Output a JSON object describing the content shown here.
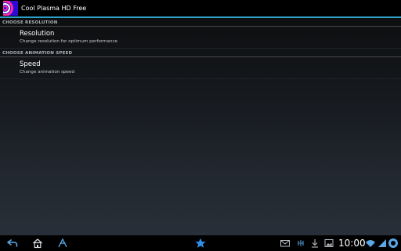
{
  "app": {
    "title": "Cool Plasma HD Free"
  },
  "sections": [
    {
      "header": "CHOOSE RESOLUTION",
      "item": {
        "title": "Resolution",
        "summary": "Change resolution for optimum performance"
      }
    },
    {
      "header": "CHOOSE ANIMATION SPEED",
      "item": {
        "title": "Speed",
        "summary": "Change animation speed"
      }
    }
  ],
  "system_bar": {
    "clock": "10:00",
    "nav_icons": [
      "back-icon",
      "home-icon",
      "recent-apps-icon"
    ],
    "center_icon": "star-icon",
    "notification_icons": [
      "mail-icon",
      "usb-debug-icon",
      "download-icon",
      "image-icon"
    ],
    "status_icons": [
      "wifi-icon",
      "signal-icon",
      "battery-icon"
    ]
  },
  "colors": {
    "accent": "#2da0c8",
    "star": "#2f8fe6",
    "icon_background": "#2b0bd8"
  }
}
